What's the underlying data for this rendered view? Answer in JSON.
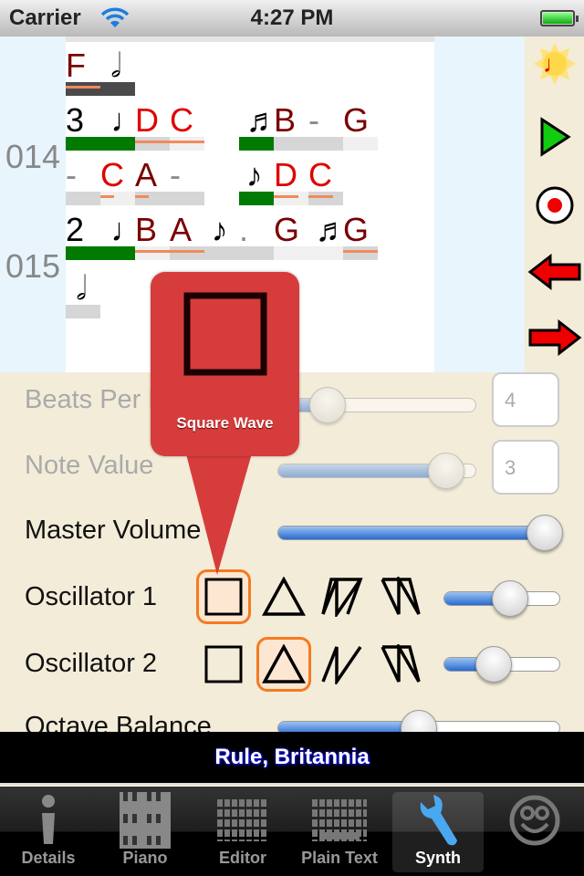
{
  "status": {
    "carrier": "Carrier",
    "time": "4:27 PM"
  },
  "score": {
    "rows": [
      {
        "num": "",
        "tokens": [
          [
            "F",
            "#7a0000",
            0
          ],
          [
            "𝅗𝅥",
            "#000",
            1.3
          ]
        ]
      },
      {
        "num": "014",
        "tokens": [
          [
            "3",
            "#000",
            0
          ],
          [
            "♩",
            "#000",
            1.3
          ],
          [
            "D",
            "#e00000",
            2
          ],
          [
            "C",
            "#e00000",
            3
          ],
          [
            "♬",
            "#000",
            5.2
          ],
          [
            "B",
            "#7a0000",
            6
          ],
          [
            "-",
            "#888",
            7
          ],
          [
            "G",
            "#7a0000",
            8
          ]
        ]
      },
      {
        "num": "",
        "tokens": [
          [
            "-",
            "#888",
            0
          ],
          [
            "C",
            "#e00000",
            1
          ],
          [
            "A",
            "#7a0000",
            2
          ],
          [
            "-",
            "#888",
            3
          ],
          [
            "♪",
            "#000",
            5.2
          ],
          [
            "D",
            "#e00000",
            6
          ],
          [
            "C",
            "#e00000",
            7
          ]
        ]
      },
      {
        "num": "015",
        "tokens": [
          [
            "2",
            "#000",
            0
          ],
          [
            "♩",
            "#000",
            1.3
          ],
          [
            "B",
            "#7a0000",
            2
          ],
          [
            "A",
            "#7a0000",
            3
          ],
          [
            "♪",
            "#000",
            4.2
          ],
          [
            ".",
            "#888",
            5
          ],
          [
            "G",
            "#7a0000",
            6
          ],
          [
            "♬",
            "#000",
            7.2
          ],
          [
            "G",
            "#7a0000",
            8
          ]
        ]
      },
      {
        "num": "",
        "tokens": [
          [
            "𝅗𝅥",
            "#000",
            0.3
          ]
        ]
      }
    ]
  },
  "toolbar": {
    "icons": [
      "note-sun-icon",
      "play-icon",
      "record-icon",
      "back-arrow-icon",
      "forward-arrow-icon"
    ]
  },
  "settings": {
    "beats_per_bar": {
      "label": "Beats Per Bar",
      "value": "4",
      "slider": 0.25
    },
    "note_value": {
      "label": "Note Value",
      "value": "3",
      "slider": 0.85
    },
    "master_volume": {
      "label": "Master Volume",
      "slider": 1.0
    },
    "oscillator1": {
      "label": "Oscillator 1",
      "selected": "square",
      "slider": 0.57
    },
    "oscillator2": {
      "label": "Oscillator 2",
      "selected": "triangle",
      "slider": 0.43
    },
    "octave_balance": {
      "label": "Octave Balance",
      "slider": 0.5
    }
  },
  "popup": {
    "label": "Square Wave"
  },
  "song_title": "Rule, Britannia",
  "tabs": [
    {
      "label": "Details",
      "icon": "info-icon"
    },
    {
      "label": "Piano",
      "icon": "piano-icon"
    },
    {
      "label": "Editor",
      "icon": "grid-icon"
    },
    {
      "label": "Plain Text",
      "icon": "keyboard-icon"
    },
    {
      "label": "Synth",
      "icon": "wrench-icon",
      "active": true
    },
    {
      "label": "",
      "icon": "smiley-icon"
    }
  ],
  "colors": {
    "accent": "#f47a20",
    "popup": "#d63c3c",
    "green": "#007a00"
  }
}
